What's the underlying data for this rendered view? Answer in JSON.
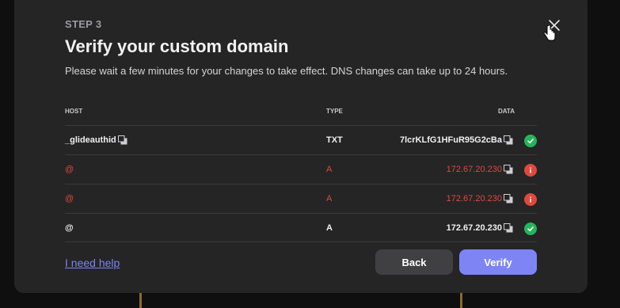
{
  "modal": {
    "step": "STEP 3",
    "title": "Verify your custom domain",
    "subtitle": "Please wait a few minutes for your changes to take effect. DNS changes can take up to 24 hours."
  },
  "table": {
    "headers": {
      "host": "HOST",
      "type": "TYPE",
      "data": "DATA"
    },
    "rows": [
      {
        "host": "_glideauthid",
        "type": "TXT",
        "data": "7lcrKLfG1HFuR95G2cBa",
        "status": "verified"
      },
      {
        "host": "@",
        "type": "A",
        "data": "172.67.20.230",
        "status": "error"
      },
      {
        "host": "@",
        "type": "A",
        "data": "172.67.20.230",
        "status": "error"
      },
      {
        "host": "@",
        "type": "A",
        "data": "172.67.20.230",
        "status": "verified"
      }
    ]
  },
  "footer": {
    "help_link": "I need help",
    "back_label": "Back",
    "verify_label": "Verify"
  },
  "colors": {
    "accent": "#7f84f5",
    "error": "#e0483e",
    "success": "#25b45a",
    "surface": "#252526"
  },
  "icons": {
    "close": "close-icon",
    "copy": "copy-icon",
    "verified": "check-circle-icon",
    "error": "info-circle-icon"
  }
}
